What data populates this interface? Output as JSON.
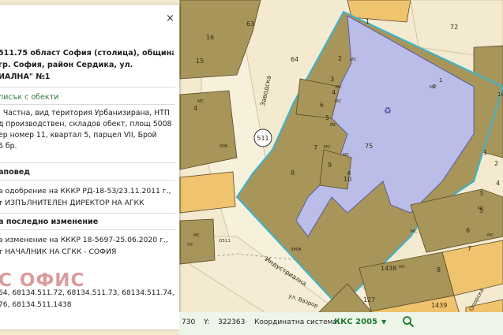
{
  "colors": {
    "background": "#f3ead0",
    "building": "#a8955a",
    "building_stroke": "#5a4a25",
    "selected_fill": "#b9bde8",
    "selected_border": "#39b4cf",
    "orange": "#f0c36e",
    "road": "#f7f1dc",
    "link_green": "#2c7b3e",
    "watermark_red": "#d68a8a"
  },
  "map": {
    "parcel_labels": [
      "63",
      "64",
      "72",
      "1",
      "2",
      "3",
      "4",
      "5",
      "6",
      "7",
      "8",
      "9",
      "10",
      "75",
      "1438",
      "127",
      "1439",
      "8",
      "6",
      "5",
      "7",
      "3",
      "1",
      "2",
      "4",
      "15",
      "16",
      "4"
    ],
    "building_codes": [
      "МС",
      "МС",
      "МС",
      "МС",
      "МС",
      "МС",
      "МС",
      "МС",
      "МС",
      "МС",
      "МС",
      "МС",
      "МЖ",
      "ЗМЖ",
      "ПС",
      "МС",
      "О511"
    ],
    "small_codes": [
      "1",
      "2",
      "10",
      "6"
    ],
    "street_names": [
      "Заводска",
      "Индустриална",
      "ул. Вазрор",
      "Опорска"
    ],
    "district_badge": "511",
    "recycle_symbol": "♻"
  },
  "panel": {
    "close_icon": "×",
    "title_lines": [
      "511.75 област София (столица), община",
      "гр. София, район Сердика, ул.",
      "ИАЛНА\" №1"
    ],
    "link_label": "писък с обекти",
    "description_lines": [
      ". Частна, вид територия Урбанизирана, НТП",
      "д производствен, складов обект, площ 5008",
      "ер номер 11, квартал 5, парцел VII, Брой",
      "6 бр."
    ],
    "order_header": "аповед",
    "order_lines": [
      "а одобрение на КККР РД-18-53/23.11.2011 г.,",
      "т ИЗПЪЛНИТЕЛЕН ДИРЕКТОР НА АГКК"
    ],
    "change_header": "а последно изменение",
    "change_lines": [
      "а изменение на КККР 18-5697-25.06.2020 г.,",
      "т НАЧАЛНИК НА СГКК - СОФИЯ"
    ],
    "watermark": "С ОФИС",
    "related_ids": [
      "64, 68134.511.72, 68134.511.73, 68134.511.74,",
      "76, 68134.511.1438"
    ]
  },
  "statusbar": {
    "x_value": "730",
    "y_label": "Y:",
    "y_value": "322363",
    "system_label": "Координатна система:",
    "system_value": "ККС 2005",
    "dropdown_icon": "▼",
    "zoom_icon": "magnifier-icon"
  }
}
